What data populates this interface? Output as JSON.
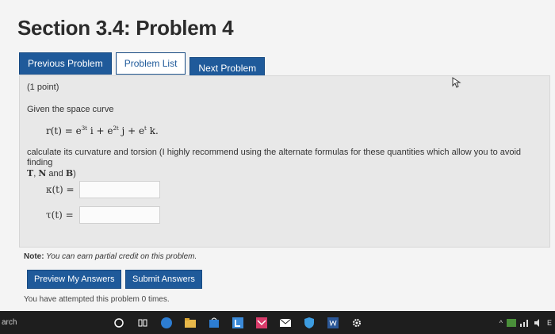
{
  "page_title": "Section 3.4: Problem 4",
  "nav": {
    "previous": "Previous Problem",
    "list": "Problem List",
    "next": "Next Problem"
  },
  "problem": {
    "points": "(1 point)",
    "given": "Given the space curve",
    "equation": {
      "lhs": "r(t) = e",
      "e1": "3t",
      "i": " i + e",
      "e2": "2t",
      "j": " j + e",
      "e3": "t",
      "k": " k."
    },
    "calc_text": "calculate its curvature and torsion (I highly recommend using the alternate formulas for these quantities which allow you to avoid finding",
    "calc_text2": " and ",
    "calc_t": "T",
    "calc_n": "N",
    "calc_b": "B",
    "calc_end": ")",
    "kappa_label": "κ(t) =",
    "tau_label": "τ(t) ="
  },
  "note": {
    "label": "Note:",
    "text": " You can earn partial credit on this problem."
  },
  "buttons": {
    "preview": "Preview My Answers",
    "submit": "Submit Answers"
  },
  "attempted": "You have attempted this problem 0 times.",
  "taskbar": {
    "search_text": "arch",
    "tray_text": "E"
  }
}
